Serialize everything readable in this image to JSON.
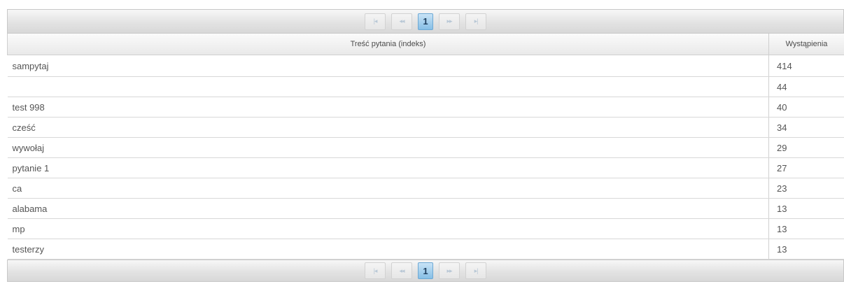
{
  "pagination": {
    "first_icon": "first-page-icon",
    "prev_icon": "prev-page-icon",
    "next_icon": "next-page-icon",
    "last_icon": "last-page-icon",
    "first_label": "|◂",
    "prev_label": "◂◂",
    "current_page": "1",
    "next_label": "▸▸",
    "last_label": "▸|"
  },
  "table": {
    "headers": [
      "Treść pytania (indeks)",
      "Wystąpienia"
    ],
    "rows": [
      {
        "question": "sampytaj",
        "count": "414"
      },
      {
        "question": "",
        "count": "44"
      },
      {
        "question": "test 998",
        "count": "40"
      },
      {
        "question": "cześć",
        "count": "34"
      },
      {
        "question": "wywołaj",
        "count": "29"
      },
      {
        "question": "pytanie 1",
        "count": "27"
      },
      {
        "question": "ca",
        "count": "23"
      },
      {
        "question": "alabama",
        "count": "13"
      },
      {
        "question": "mp",
        "count": "13"
      },
      {
        "question": "testerzy",
        "count": "13"
      }
    ]
  },
  "colors": {
    "accent": "#86bfe6",
    "header_bg": "#e9e9e9",
    "border": "#cfcfcf"
  }
}
